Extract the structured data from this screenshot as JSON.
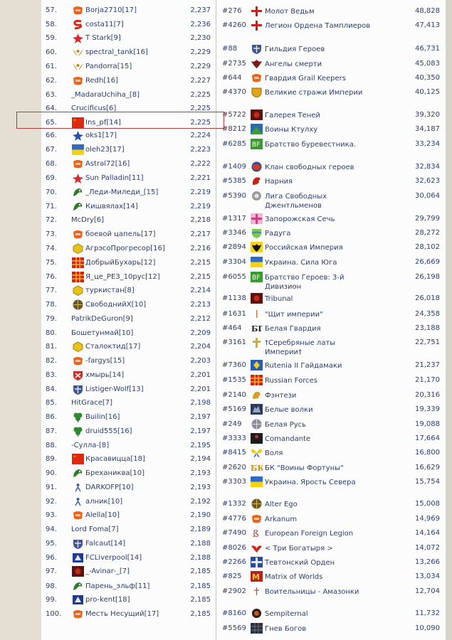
{
  "players": [
    {
      "rank": "57.",
      "name": "Borja2710[17]",
      "points": "2,237",
      "icon": "orange-shield-icon"
    },
    {
      "rank": "58.",
      "name": "costa11[7]",
      "points": "2,236",
      "icon": "red-s-icon"
    },
    {
      "rank": "59.",
      "name": "T Stark[9]",
      "points": "2,230",
      "icon": "red-star-icon"
    },
    {
      "rank": "60.",
      "name": "spectral_tank[16]",
      "points": "2,229",
      "icon": "wings-icon"
    },
    {
      "rank": "61.",
      "name": "Pandorra[15]",
      "points": "2,229",
      "icon": "wings-icon"
    },
    {
      "rank": "62.",
      "name": "Redh[16]",
      "points": "2,227",
      "icon": "orange-shield-icon"
    },
    {
      "rank": "63.",
      "name": "_MadaraUchiha_[8]",
      "points": "2,225",
      "icon": ""
    },
    {
      "rank": "64.",
      "name": "Crucificus[6]",
      "points": "2,225",
      "icon": ""
    },
    {
      "rank": "65.",
      "name": "Ins_pf[14]",
      "points": "2,225",
      "icon": "china-flag-icon"
    },
    {
      "rank": "66.",
      "name": "oks1[17]",
      "points": "2,224",
      "icon": "blue-star-icon"
    },
    {
      "rank": "67.",
      "name": "oleh23[17]",
      "points": "2,223",
      "icon": "ukraine-flag-icon"
    },
    {
      "rank": "68.",
      "name": "Astral72[16]",
      "points": "2,222",
      "icon": "orange-shield-icon"
    },
    {
      "rank": "69.",
      "name": "Sun Palladin[11]",
      "points": "2,221",
      "icon": "red-star-icon"
    },
    {
      "rank": "70.",
      "name": "_Леди-Миледи_[15]",
      "points": "2,219",
      "icon": "green-dragon-icon"
    },
    {
      "rank": "71.",
      "name": "Кишвялах[14]",
      "points": "2,219",
      "icon": "green-dragon-icon"
    },
    {
      "rank": "72.",
      "name": "McDry[6]",
      "points": "2,218",
      "icon": ""
    },
    {
      "rank": "73.",
      "name": "боевой цапель[17]",
      "points": "2,217",
      "icon": "orange-shield-icon"
    },
    {
      "rank": "74.",
      "name": "АгрэсоПрогресор[16]",
      "points": "2,216",
      "icon": "yellow-hexagon-icon"
    },
    {
      "rank": "75.",
      "name": "ДобрыйБухарь[12]",
      "points": "2,215",
      "icon": "red-grid-icon"
    },
    {
      "rank": "76.",
      "name": "Я_це_РЕЗ_10рус[12]",
      "points": "2,215",
      "icon": "red-grid-icon"
    },
    {
      "rank": "77.",
      "name": "туркистан[8]",
      "points": "2,214",
      "icon": "yellow-hexagon-icon"
    },
    {
      "rank": "78.",
      "name": "СвободнийХ[10]",
      "points": "2,213",
      "icon": "dark-globe-icon"
    },
    {
      "rank": "79.",
      "name": "PatrikDeGuron[9]",
      "points": "2,212",
      "icon": ""
    },
    {
      "rank": "80.",
      "name": "Бошетунмай[10]",
      "points": "2,209",
      "icon": ""
    },
    {
      "rank": "81.",
      "name": "Сталоктид[17]",
      "points": "2,204",
      "icon": "yellow-hexagon-icon"
    },
    {
      "rank": "82.",
      "name": "-fargys[15]",
      "points": "2,203",
      "icon": "orange-shield-icon"
    },
    {
      "rank": "83.",
      "name": "хмырь[14]",
      "points": "2,201",
      "icon": "red-shield-icon"
    },
    {
      "rank": "84.",
      "name": "Listiger-Wolf[13]",
      "points": "2,201",
      "icon": "blue-shield-icon"
    },
    {
      "rank": "85.",
      "name": "HitGrace[7]",
      "points": "2,198",
      "icon": ""
    },
    {
      "rank": "86.",
      "name": "Builin[16]",
      "points": "2,197",
      "icon": "green-clover-icon"
    },
    {
      "rank": "87.",
      "name": "druid555[16]",
      "points": "2,197",
      "icon": "green-clover-icon"
    },
    {
      "rank": "88.",
      "name": "-Сулла-[8]",
      "points": "2,195",
      "icon": ""
    },
    {
      "rank": "89.",
      "name": "Красавицца[18]",
      "points": "2,194",
      "icon": "china-flag-icon"
    },
    {
      "rank": "90.",
      "name": "Бреханиквa[10]",
      "points": "2,193",
      "icon": "green-dragon-icon"
    },
    {
      "rank": "91.",
      "name": "DARKOFP[10]",
      "points": "2,193",
      "icon": "small-figure-icon"
    },
    {
      "rank": "92.",
      "name": "алник[10]",
      "points": "2,192",
      "icon": "small-figure-icon"
    },
    {
      "rank": "93.",
      "name": "Alella[10]",
      "points": "2,190",
      "icon": "orange-shield-icon"
    },
    {
      "rank": "94.",
      "name": "Lord Foma[7]",
      "points": "2,189",
      "icon": ""
    },
    {
      "rank": "95.",
      "name": "Falcaut[14]",
      "points": "2,188",
      "icon": "blue-shield-icon"
    },
    {
      "rank": "96.",
      "name": "FCLiverpool[14]",
      "points": "2,188",
      "icon": "blue-emblem-icon"
    },
    {
      "rank": "97.",
      "name": "_-Avinar-_[7]",
      "points": "2,185",
      "icon": "red-dark-icon"
    },
    {
      "rank": "98.",
      "name": "Парень_эльф[11]",
      "points": "2,185",
      "icon": "green-dragon-icon"
    },
    {
      "rank": "99.",
      "name": "pro-kent[18]",
      "points": "2,185",
      "icon": "blue-emblem-icon"
    },
    {
      "rank": "100.",
      "name": "Месть Несущий[17]",
      "points": "2,185",
      "icon": "orange-shield-icon"
    }
  ],
  "guilds": [
    {
      "rank": "#276",
      "name": "Молот Ведьм",
      "points": "48,828",
      "icon": "red-cross-icon"
    },
    {
      "rank": "#4260",
      "name": "Легион Ордена Тамплиеров",
      "points": "47,413",
      "icon": "red-cross-icon"
    },
    {
      "rank": "#88",
      "name": "Гильдия Героев",
      "points": "46,731",
      "icon": "blue-shield-icon"
    },
    {
      "rank": "#2735",
      "name": "Ангелы смерти",
      "points": "45,083",
      "icon": "dark-eagle-icon"
    },
    {
      "rank": "#644",
      "name": "Гвардия Grail Keepers",
      "points": "40,350",
      "icon": "orange-shield-icon"
    },
    {
      "rank": "#4370",
      "name": "Великие стражи Империи",
      "points": "40,125",
      "icon": "gold-shield-icon"
    },
    {
      "rank": "#5722",
      "name": "Галерея Теней",
      "points": "39,320",
      "icon": "red-dark-icon"
    },
    {
      "rank": "#8212",
      "name": "Воины Ктулху",
      "points": "34,187",
      "icon": "green-blue-icon"
    },
    {
      "rank": "#6285",
      "name": "Братство буревестника.",
      "points": "33,234",
      "icon": "green-text-icon"
    },
    {
      "rank": "#1409",
      "name": "Клан свободных героев",
      "points": "32,834",
      "icon": "red-globe-icon"
    },
    {
      "rank": "#5385",
      "name": "Нарния",
      "points": "32,623",
      "icon": "red-lion-icon"
    },
    {
      "rank": "#5390",
      "name": "Лига Свободных Джентльменов",
      "points": "30,064",
      "icon": "grey-circle-icon"
    },
    {
      "rank": "#1317",
      "name": "Запорожская Сечь",
      "points": "29,799",
      "icon": "pink-cross-icon"
    },
    {
      "rank": "#3346",
      "name": "Радуга",
      "points": "28,272",
      "icon": "green-shield-icon"
    },
    {
      "rank": "#2894",
      "name": "Российская Империя",
      "points": "28,102",
      "icon": "black-eagle-icon"
    },
    {
      "rank": "#3304",
      "name": "Украина. Сила Юга",
      "points": "26,669",
      "icon": "ukraine-flag-icon"
    },
    {
      "rank": "#6055",
      "name": "Братство Героев: 3-й Дивизион",
      "points": "26,198",
      "icon": "green-text-icon"
    },
    {
      "rank": "#1138",
      "name": "Tribunal",
      "points": "26,018",
      "icon": "red-dark-icon"
    },
    {
      "rank": "#1631",
      "name": "\"Щит империи\"",
      "points": "24,358",
      "icon": "thin-line-icon"
    },
    {
      "rank": "#464",
      "name": "Белая Гвардия",
      "points": "23,188",
      "icon": "bg-letters-icon"
    },
    {
      "rank": "#3161",
      "name": "†Серебряные латы Империи†",
      "points": "22,751",
      "icon": "gold-cross-icon"
    },
    {
      "rank": "#7360",
      "name": "Rutenia II Гайдамаки",
      "points": "21,237",
      "icon": "blue-yellow-icon"
    },
    {
      "rank": "#1535",
      "name": "Russian Forces",
      "points": "21,170",
      "icon": "red-grid-icon"
    },
    {
      "rank": "#2140",
      "name": "Фэнтези",
      "points": "20,316",
      "icon": "gold-lion-icon"
    },
    {
      "rank": "#5169",
      "name": "Белые волки",
      "points": "19,339",
      "icon": "dark-wolf-icon"
    },
    {
      "rank": "#249",
      "name": "Белая Русь",
      "points": "19,088",
      "icon": "grey-globe-icon"
    },
    {
      "rank": "#3333",
      "name": "Comandante",
      "points": "17,664",
      "icon": "dark-figure-icon"
    },
    {
      "rank": "#8415",
      "name": "Воля",
      "points": "16,800",
      "icon": "yellow-butterfly-icon"
    },
    {
      "rank": "#2620",
      "name": "БК \"Воины Фортуны\"",
      "points": "16,629",
      "icon": "gold-bk-icon"
    },
    {
      "rank": "#3303",
      "name": "Украина. Ярость Севера",
      "points": "15,754",
      "icon": "ukraine-flag-icon"
    },
    {
      "rank": "#1332",
      "name": "Alter Ego",
      "points": "15,008",
      "icon": "dark-globe-icon"
    },
    {
      "rank": "#4776",
      "name": "Arkanum",
      "points": "14,969",
      "icon": "orange-shield-icon"
    },
    {
      "rank": "#7490",
      "name": "European Foreign Legion",
      "points": "14,164",
      "icon": "red-b-icon"
    },
    {
      "rank": "#8026",
      "name": "< Три Богатыря >",
      "points": "14,072",
      "icon": "red-bird-icon"
    },
    {
      "rank": "#2266",
      "name": "Тевтонский Орден",
      "points": "13,266",
      "icon": "blue-cross-icon"
    },
    {
      "rank": "#825",
      "name": "Matrix of Worlds",
      "points": "13,034",
      "icon": "red-m-icon"
    },
    {
      "rank": "#2902",
      "name": "Воительницы - Амазонки",
      "points": "12,704",
      "icon": "thin-figure-icon"
    },
    {
      "rank": "#8160",
      "name": "Sempiternal",
      "points": "11,732",
      "icon": "dark-circle-icon"
    },
    {
      "rank": "#5569",
      "name": "Гнев Богов",
      "points": "10,090",
      "icon": "dark-grid-icon"
    }
  ]
}
